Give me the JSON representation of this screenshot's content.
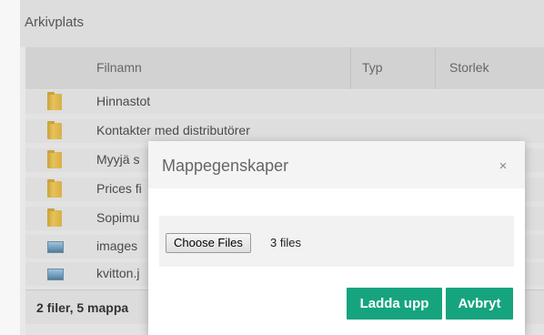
{
  "panel": {
    "title": "Arkivplats"
  },
  "grid": {
    "columns": {
      "name": "Filnamn",
      "type": "Typ",
      "size": "Storlek"
    },
    "rows": [
      {
        "icon": "folder-icon",
        "name": "Hinnastot"
      },
      {
        "icon": "folder-icon",
        "name": "Kontakter med distributörer"
      },
      {
        "icon": "folder-icon",
        "name": "Myyjä s"
      },
      {
        "icon": "folder-icon",
        "name": "Prices fi"
      },
      {
        "icon": "folder-icon",
        "name": "Sopimu"
      },
      {
        "icon": "image-icon",
        "name": "images"
      },
      {
        "icon": "image-icon",
        "name": "kvitton.j"
      }
    ],
    "summary": "2 filer, 5 mappa"
  },
  "modal": {
    "title": "Mappegenskaper",
    "close_symbol": "×",
    "choose_files_label": "Choose Files",
    "file_count": "3 files",
    "upload_label": "Ladda upp",
    "cancel_label": "Avbryt"
  },
  "colors": {
    "accent": "#16a47e",
    "folder": "#d8b044"
  }
}
